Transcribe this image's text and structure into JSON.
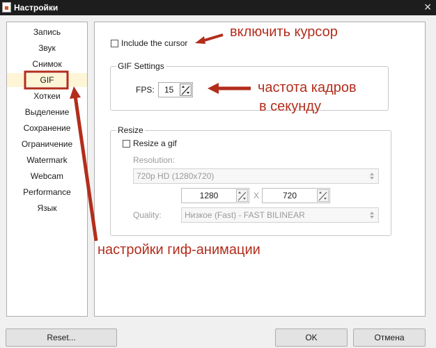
{
  "window": {
    "title": "Настройки",
    "app_icon": "app-icon",
    "close_icon": "close-icon"
  },
  "sidebar": {
    "items": [
      {
        "label": "Запись"
      },
      {
        "label": "Звук"
      },
      {
        "label": "Снимок"
      },
      {
        "label": "GIF",
        "selected": true
      },
      {
        "label": "Хоткеи"
      },
      {
        "label": "Выделение"
      },
      {
        "label": "Сохранение"
      },
      {
        "label": "Ограничение"
      },
      {
        "label": "Watermark"
      },
      {
        "label": "Webcam"
      },
      {
        "label": "Performance"
      },
      {
        "label": "Язык"
      }
    ]
  },
  "gif_panel": {
    "include_cursor": {
      "label": "Include the cursor",
      "checked": false
    },
    "gif_settings": {
      "title": "GIF Settings",
      "fps_label": "FPS:",
      "fps_value": "15"
    },
    "resize": {
      "title": "Resize",
      "resize_checkbox": {
        "label": "Resize a gif",
        "checked": false
      },
      "resolution_label": "Resolution:",
      "resolution_value": "720p HD (1280x720)",
      "width_value": "1280",
      "x_label": "X",
      "height_value": "720",
      "quality_label": "Quality:",
      "quality_value": "Низкое (Fast) - FAST BILINEAR"
    }
  },
  "buttons": {
    "reset": "Reset...",
    "ok": "OK",
    "cancel": "Отмена"
  },
  "annotations": {
    "cursor": "включить курсор",
    "fps_line1": "частота кадров",
    "fps_line2": "в секунду",
    "gif": "настройки гиф-анимации",
    "color": "#b32d1c"
  }
}
